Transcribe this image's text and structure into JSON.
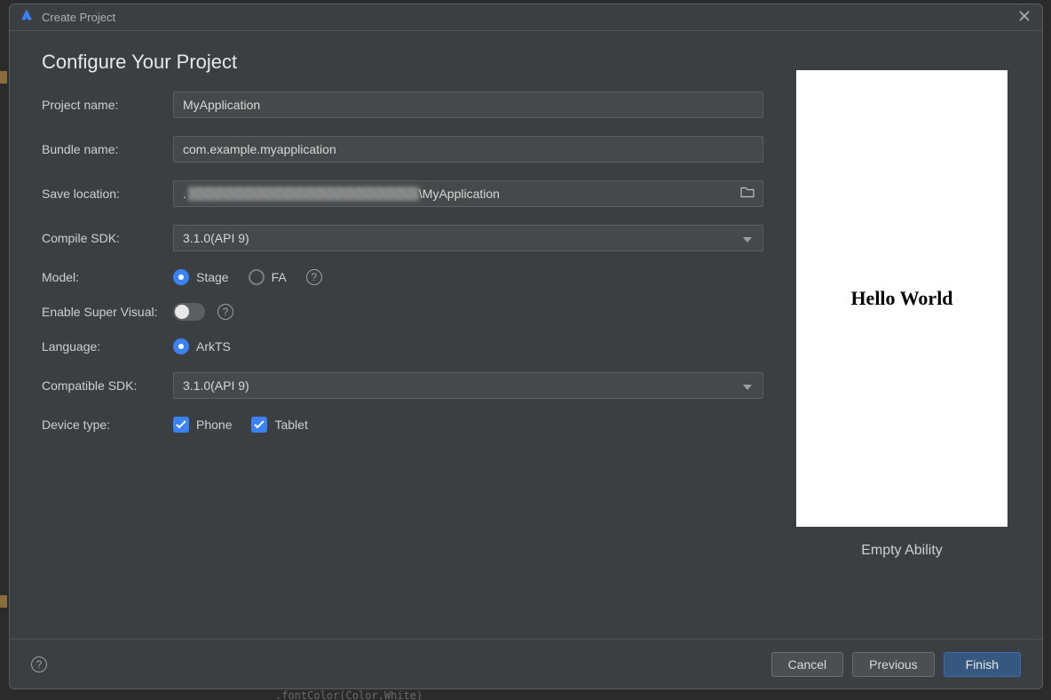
{
  "window": {
    "title": "Create Project"
  },
  "page": {
    "title": "Configure Your Project"
  },
  "fields": {
    "project_name": {
      "label": "Project name:",
      "value": "MyApplication"
    },
    "bundle_name": {
      "label": "Bundle name:",
      "value": "com.example.myapplication"
    },
    "save_location": {
      "label": "Save location:",
      "suffix": "\\MyApplication"
    },
    "compile_sdk": {
      "label": "Compile SDK:",
      "value": "3.1.0(API 9)"
    },
    "model": {
      "label": "Model:",
      "options": {
        "stage": "Stage",
        "fa": "FA"
      },
      "selected": "stage"
    },
    "super_visual": {
      "label": "Enable Super Visual:",
      "on": false
    },
    "language": {
      "label": "Language:",
      "options": {
        "arkts": "ArkTS"
      },
      "selected": "arkts"
    },
    "compatible_sdk": {
      "label": "Compatible SDK:",
      "value": "3.1.0(API 9)"
    },
    "device_type": {
      "label": "Device type:",
      "options": {
        "phone": "Phone",
        "tablet": "Tablet"
      },
      "checked": [
        "phone",
        "tablet"
      ]
    }
  },
  "preview": {
    "text": "Hello World",
    "caption": "Empty Ability"
  },
  "footer": {
    "cancel": "Cancel",
    "previous": "Previous",
    "finish": "Finish"
  }
}
